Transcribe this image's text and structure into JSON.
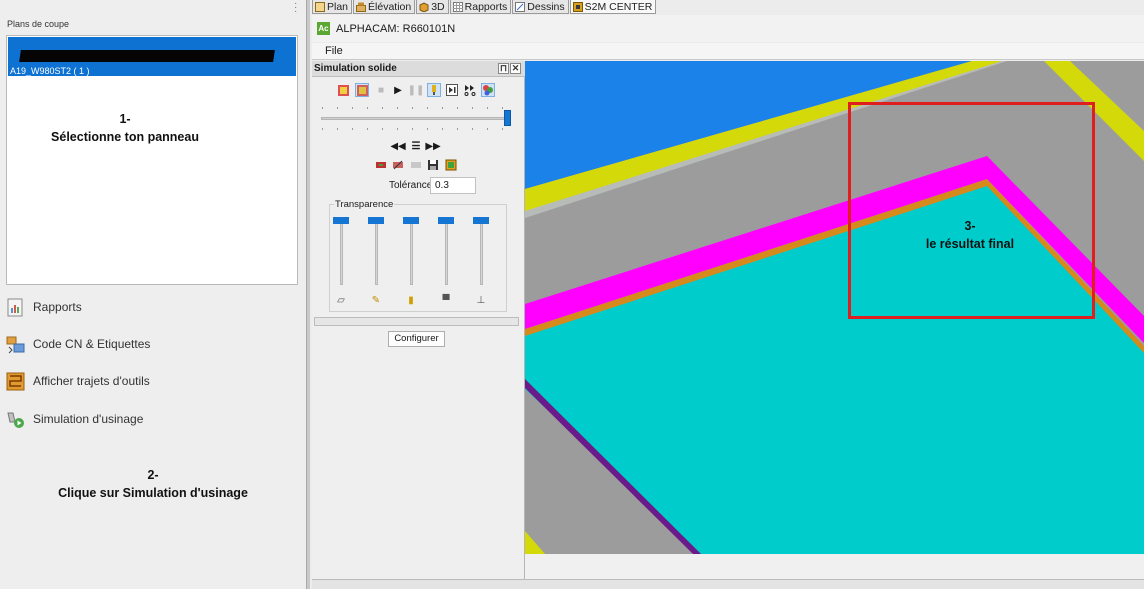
{
  "left_panel": {
    "caption": "Plans de coupe",
    "list_item_label": "A19_W980ST2  ( 1 )",
    "nav": [
      {
        "label": "Rapports",
        "icon": "report-icon"
      },
      {
        "label": "Code CN & Etiquettes",
        "icon": "nc-code-icon"
      },
      {
        "label": "Afficher trajets d'outils",
        "icon": "toolpath-icon"
      },
      {
        "label": "Simulation d'usinage",
        "icon": "simulation-icon"
      }
    ],
    "note1": {
      "line1": "1-",
      "line2": "Sélectionne ton panneau"
    },
    "note2": {
      "line1": "2-",
      "line2": "Clique sur Simulation d'usinage"
    }
  },
  "tabs": [
    {
      "label": "Plan",
      "icon": "plan-icon",
      "active": false
    },
    {
      "label": "Élévation",
      "icon": "elevation-icon",
      "active": false
    },
    {
      "label": "3D",
      "icon": "cube-icon",
      "active": false
    },
    {
      "label": "Rapports",
      "icon": "grid-icon",
      "active": false
    },
    {
      "label": "Dessins",
      "icon": "drawing-icon",
      "active": false
    },
    {
      "label": "S2M CENTER",
      "icon": "s2m-icon",
      "active": true
    }
  ],
  "window": {
    "logo": "Ac",
    "title": "ALPHACAM: R660101N"
  },
  "menu": {
    "file": "File"
  },
  "simulation": {
    "title": "Simulation solide",
    "tolerance_label": "Tolérance",
    "tolerance_value": "0.3",
    "transparence_label": "Transparence",
    "configure_label": "Configurer",
    "slider_position": 1.0
  },
  "viewport": {
    "note3": {
      "line1": "3-",
      "line2": "le résultat final"
    },
    "colors": {
      "sky": "#1a82e8",
      "gray": "#9c9c9c",
      "yellow": "#d4d90a",
      "magenta": "#ff00ff",
      "orange": "#d78a1c",
      "cyan": "#00cccc",
      "purple": "#6a1a8a",
      "annotation": "#e01e1e"
    }
  }
}
